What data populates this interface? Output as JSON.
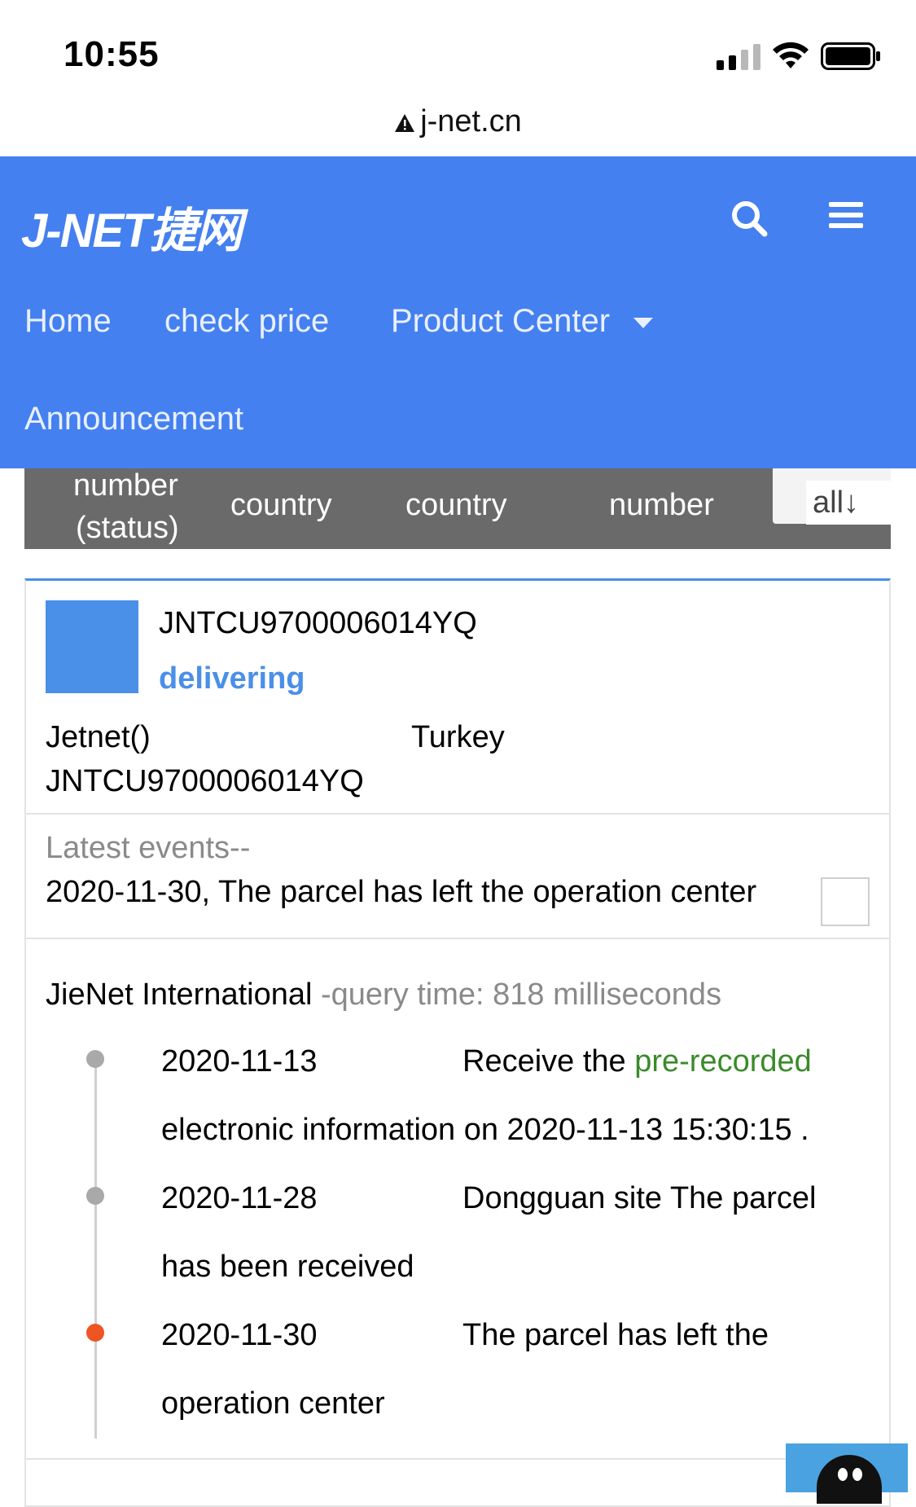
{
  "status_bar": {
    "time": "10:55"
  },
  "browser": {
    "url": "j-net.cn"
  },
  "header": {
    "logo_text": "J-NET捷网",
    "nav": {
      "home": "Home",
      "check_price": "check price",
      "product_center": "Product Center",
      "announcement": "Announcement"
    }
  },
  "table_header": {
    "col1_line1": "number",
    "col1_line2": "(status)",
    "col2": "country",
    "col3": "country",
    "col4": "number",
    "select_all": "all↓"
  },
  "shipment": {
    "tracking_number": "JNTCU9700006014YQ",
    "status": "delivering",
    "carrier": "Jetnet()",
    "destination": "Turkey",
    "tracking_number_2": "JNTCU9700006014YQ",
    "latest_label": "Latest events--",
    "latest_event": "2020-11-30, The parcel has left the operation center"
  },
  "tracking_detail": {
    "company": "JieNet International",
    "query_time": " -query time: 818 milliseconds",
    "events": [
      {
        "date": "2020-11-13",
        "desc_a": "Receive the ",
        "desc_b": "pre-recorded",
        "desc_cont": "electronic information on 2020-11-13 15:30:15 ."
      },
      {
        "date": "2020-11-28",
        "desc_a": "Dongguan site The parcel",
        "desc_cont": "has been received"
      },
      {
        "date": "2020-11-30",
        "desc_a": "The parcel has left the",
        "desc_cont": "operation center"
      }
    ]
  },
  "colors": {
    "header_bg": "#4580f0",
    "status_blue": "#4a8fe8",
    "highlight_green": "#3a8b2a",
    "active_dot": "#ef5423",
    "table_header_bg": "#6a6a6a"
  }
}
